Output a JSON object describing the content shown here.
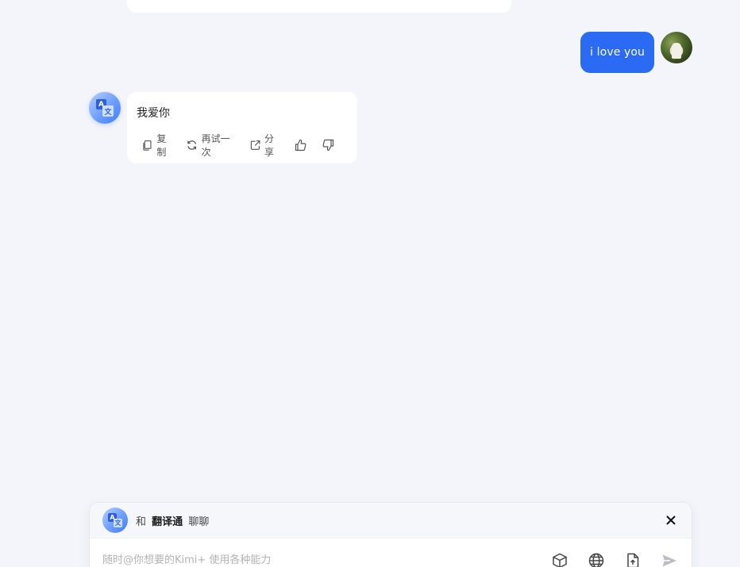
{
  "user_message": {
    "text": "i love you",
    "bubble_color": "#2b6bf3"
  },
  "bot_message": {
    "text": "我爱你",
    "actions": {
      "copy_label": "复制",
      "retry_label": "再试一次",
      "share_label": "分享"
    },
    "icons": [
      "copy-icon",
      "refresh-icon",
      "share-icon",
      "thumbs-up-icon",
      "thumbs-down-icon"
    ]
  },
  "composer": {
    "prefix": "和",
    "bot_name": "翻译通",
    "suffix": "聊聊",
    "placeholder": "随时@你想要的Kimi+ 使用各种能力",
    "tools": [
      "cube-icon",
      "globe-icon",
      "file-upload-icon",
      "send-icon"
    ],
    "close_icon": "close-icon"
  },
  "colors": {
    "background": "#f4f5fb",
    "accent": "#2b6bf3"
  }
}
